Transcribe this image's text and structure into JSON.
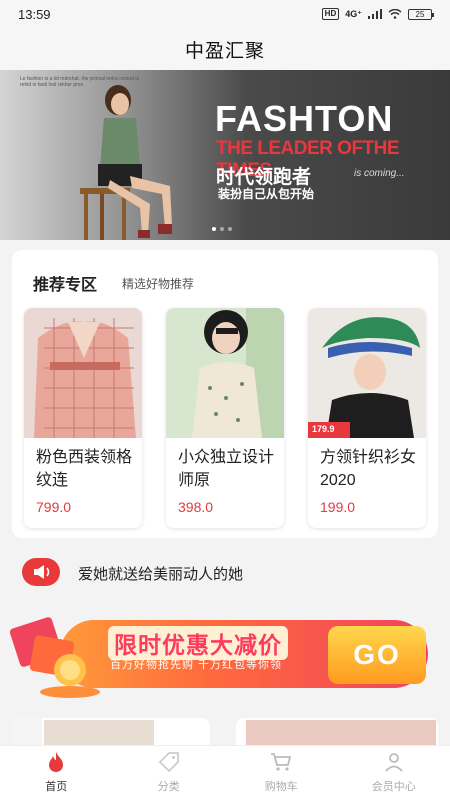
{
  "status_bar": {
    "time": "13:59",
    "hd": "HD",
    "network": "4G⁺",
    "battery": "25"
  },
  "header": {
    "title": "中盈汇聚"
  },
  "banner": {
    "tiny_text": "Le fashion is a lot mdrehat. Ihe prorsal entra ceniod is rehid in fasti Inol rekher pros",
    "headline": "FASHTON",
    "tagline": "THE LEADER OFTHE TIMES",
    "cn_title": "时代领跑者",
    "coming": "is coming...",
    "cn_sub": "装扮自己从包开始",
    "dots": [
      true,
      false,
      false
    ]
  },
  "recommend": {
    "title": "推荐专区",
    "subtitle": "精选好物推荐",
    "products": [
      {
        "name": "粉色西装领格纹连",
        "price": "799.0",
        "image": "pink-plaid-blazer-dress"
      },
      {
        "name": "小众独立设计师原",
        "price": "398.0",
        "image": "floral-dress"
      },
      {
        "name": "方领针织衫女2020",
        "price": "199.0",
        "image": "square-neck-knit-top",
        "tag_price": "179.9"
      }
    ]
  },
  "notice": {
    "icon": "megaphone-icon",
    "text": "爱她就送给美丽动人的她"
  },
  "promo": {
    "title": "限时优惠大减价",
    "subtitle": "百万好物抢先购  千万红包等你领",
    "go_label": "GO"
  },
  "tabbar": {
    "tabs": [
      {
        "label": "首页",
        "icon": "flame-icon",
        "active": true
      },
      {
        "label": "分类",
        "icon": "tag-icon",
        "active": false
      },
      {
        "label": "购物车",
        "icon": "cart-icon",
        "active": false
      },
      {
        "label": "会员中心",
        "icon": "user-icon",
        "active": false
      }
    ]
  },
  "colors": {
    "accent_red": "#e8383d",
    "active_tab": "#e83a3a"
  }
}
